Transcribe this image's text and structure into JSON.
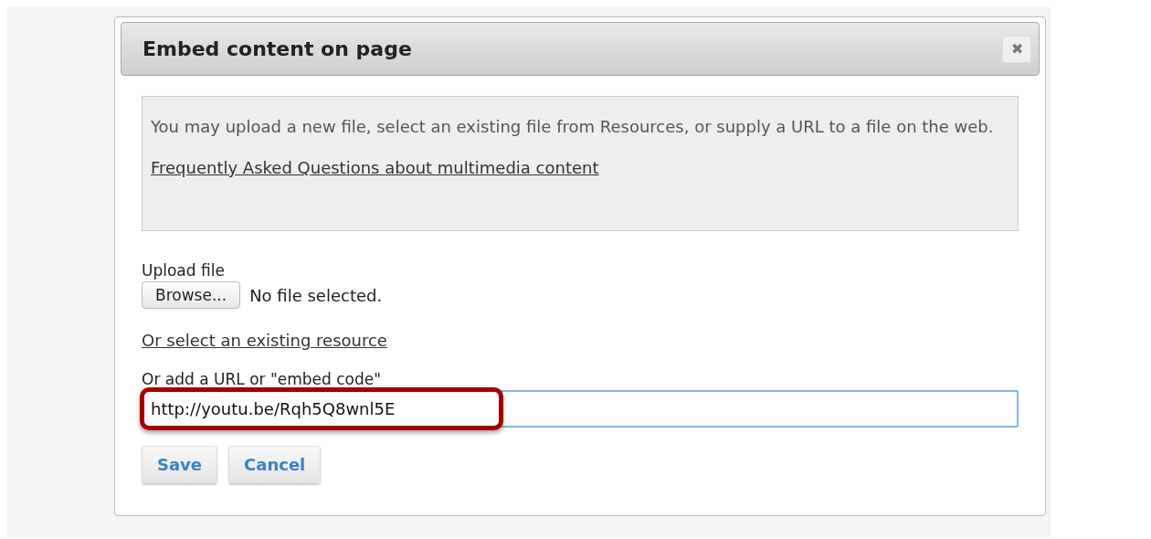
{
  "dialog": {
    "title": "Embed content on page",
    "close": "✖"
  },
  "info": {
    "text": "You may upload a new file, select an existing file from Resources, or supply a URL to a file on the web.",
    "link": "Frequently Asked Questions about multimedia content"
  },
  "upload": {
    "label": "Upload file",
    "button": "Browse...",
    "status": "No file selected."
  },
  "resource_link": "Or select an existing resource",
  "url": {
    "label": "Or add a URL or \"embed code\"",
    "value": "http://youtu.be/Rqh5Q8wnl5E",
    "highlighted": true
  },
  "buttons": [
    "Save",
    "Cancel"
  ]
}
